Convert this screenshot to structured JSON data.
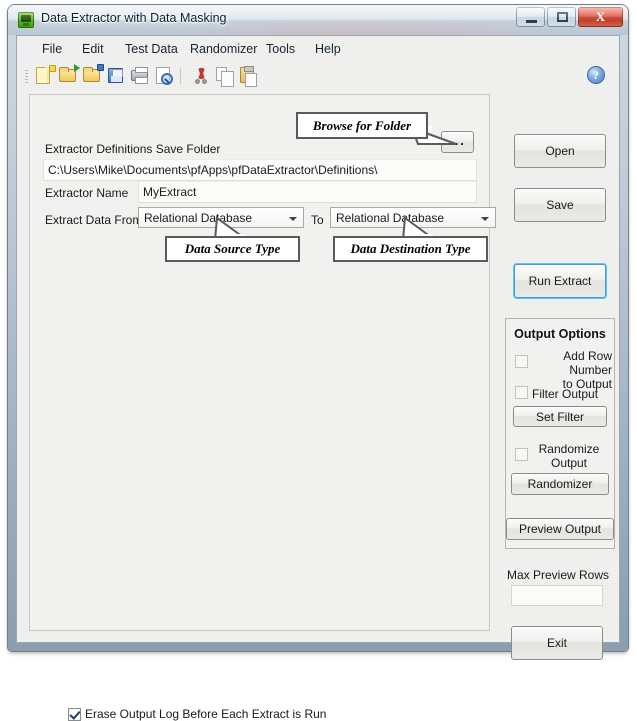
{
  "window": {
    "title": "Data Extractor with Data Masking",
    "app_icon": "green-monitor-icon",
    "minimize": "–",
    "maximize": "□",
    "close": "X"
  },
  "menubar": {
    "items": [
      {
        "label": "File"
      },
      {
        "label": "Edit"
      },
      {
        "label": "Test Data"
      },
      {
        "label": "Randomizer"
      },
      {
        "label": "Tools"
      },
      {
        "label": "Help"
      }
    ]
  },
  "toolbar": {
    "icons": [
      {
        "name": "new-document-icon"
      },
      {
        "name": "open-folder-icon"
      },
      {
        "name": "save-as-folder-icon"
      },
      {
        "name": "save-floppy-icon"
      },
      {
        "name": "print-icon"
      },
      {
        "name": "print-preview-icon"
      },
      {
        "name": "cut-scissors-icon"
      },
      {
        "name": "copy-icon"
      },
      {
        "name": "paste-icon"
      }
    ],
    "help_icon_label": "?"
  },
  "form": {
    "save_folder_label": "Extractor Definitions Save Folder",
    "save_folder_value": "C:\\Users\\Mike\\Documents\\pfApps\\pfDataExtractor\\Definitions\\",
    "browse_button_label": "...",
    "extractor_name_label": "Extractor Name",
    "extractor_name_value": "MyExtract",
    "extract_from_label": "Extract Data From",
    "extract_from_value": "Relational Database",
    "to_label": "To",
    "extract_to_value": "Relational Database",
    "erase_log_checked": true,
    "erase_log_label": "Erase Output Log Before Each Extract is Run"
  },
  "actions": {
    "open": "Open",
    "save": "Save",
    "run_extract": "Run Extract",
    "exit": "Exit"
  },
  "output_options": {
    "title": "Output Options",
    "add_row_number_checked": false,
    "add_row_number_label_line1": "Add Row Number",
    "add_row_number_label_line2": "to Output",
    "filter_output_checked": false,
    "filter_output_label": "Filter Output",
    "set_filter_button": "Set Filter",
    "randomize_output_checked": false,
    "randomize_output_label_line1": "Randomize",
    "randomize_output_label_line2": "Output",
    "randomizer_button": "Randomizer",
    "preview_output_button": "Preview Output"
  },
  "preview": {
    "max_rows_label": "Max Preview Rows",
    "max_rows_value": ""
  },
  "annotations": {
    "browse": "Browse for Folder",
    "source": "Data Source Type",
    "destination": "Data Destination Type"
  },
  "colors": {
    "accent_focus": "#3c9fe0",
    "close_button": "#d84a34",
    "client_background": "#f2f2f0",
    "title_text": "#0b2233"
  }
}
